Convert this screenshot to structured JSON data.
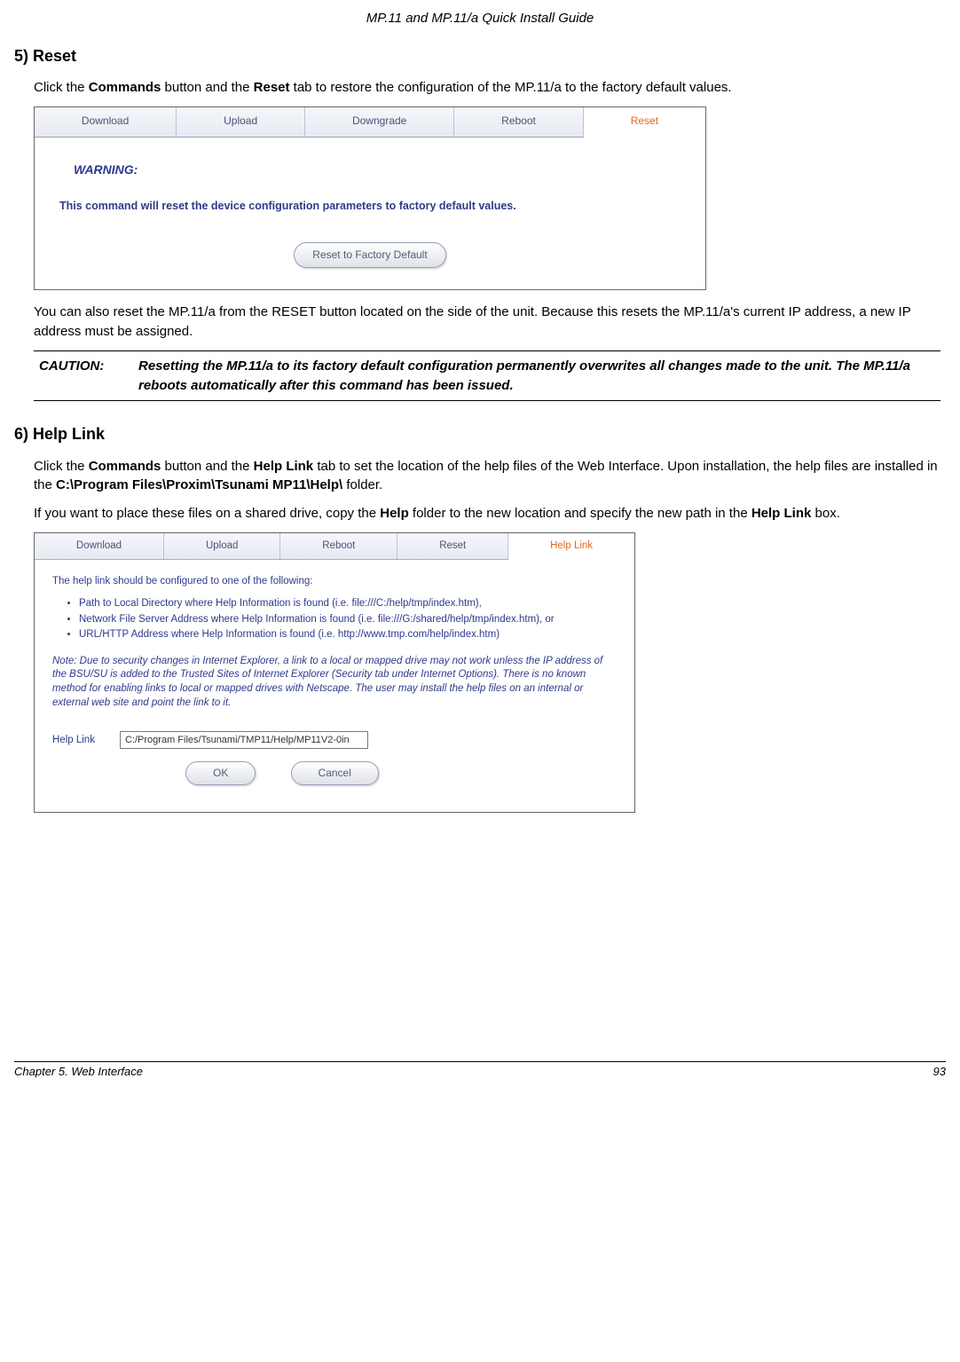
{
  "header_title": "MP.11 and MP.11/a Quick Install Guide",
  "section_reset": {
    "heading": "5) Reset",
    "para1_pre": "Click the ",
    "para1_b1": "Commands",
    "para1_mid": " button and the ",
    "para1_b2": "Reset",
    "para1_post": " tab to restore the configuration of the MP.11/a to the factory default values.",
    "para2": "You can also reset the MP.11/a from the RESET button located on the side of the unit.  Because this resets the MP.11/a's current IP address, a new IP address must be assigned.",
    "caution_label": "CAUTION:",
    "caution_text": "Resetting the MP.11/a to its factory default configuration permanently overwrites all changes made to the unit.  The MP.11/a reboots automatically after this command has been issued."
  },
  "shot1": {
    "tabs": [
      "Download",
      "Upload",
      "Downgrade",
      "Reboot",
      "Reset"
    ],
    "active_index": 4,
    "warning_label": "WARNING:",
    "warning_text": "This command will reset the device configuration parameters to factory default values.",
    "button": "Reset to Factory Default"
  },
  "section_help": {
    "heading": "6) Help Link",
    "para1_pre": "Click the ",
    "para1_b1": "Commands",
    "para1_mid": " button and the ",
    "para1_b2": "Help Link",
    "para1_mid2": " tab to set the location of the help files of the Web Interface.  Upon installation, the help files are installed in the ",
    "para1_b3": "C:\\Program Files\\Proxim\\Tsunami MP11\\Help\\",
    "para1_post": " folder.",
    "para2_pre": "If you want to place these files on a shared drive, copy the ",
    "para2_b1": "Help",
    "para2_mid": " folder to the new location and specify the new path in the ",
    "para2_b2": "Help Link",
    "para2_post": " box."
  },
  "shot2": {
    "tabs": [
      "Download",
      "Upload",
      "Reboot",
      "Reset",
      "Help Link"
    ],
    "active_index": 4,
    "intro": "The help link should be configured to one of the following:",
    "bullets": [
      "Path to Local Directory where Help Information is found (i.e. file:///C:/help/tmp/index.htm),",
      "Network File Server Address where Help Information is found (i.e. file:///G:/shared/help/tmp/index.htm), or",
      "URL/HTTP Address where Help Information is found (i.e. http://www.tmp.com/help/index.htm)"
    ],
    "note": "Note: Due to security changes in Internet Explorer, a link to a local or mapped drive may not work unless the IP address of the BSU/SU is added to the Trusted Sites of Internet Explorer (Security tab under Internet Options). There is no known method for enabling links to local or mapped drives with Netscape. The user may install the help files on an internal or external web site and point the link to it.",
    "field_label": "Help Link",
    "field_value": "C:/Program Files/Tsunami/TMP11/Help/MP11V2-0in",
    "ok": "OK",
    "cancel": "Cancel"
  },
  "footer": {
    "left": "Chapter 5.  Web Interface",
    "right": "93"
  }
}
